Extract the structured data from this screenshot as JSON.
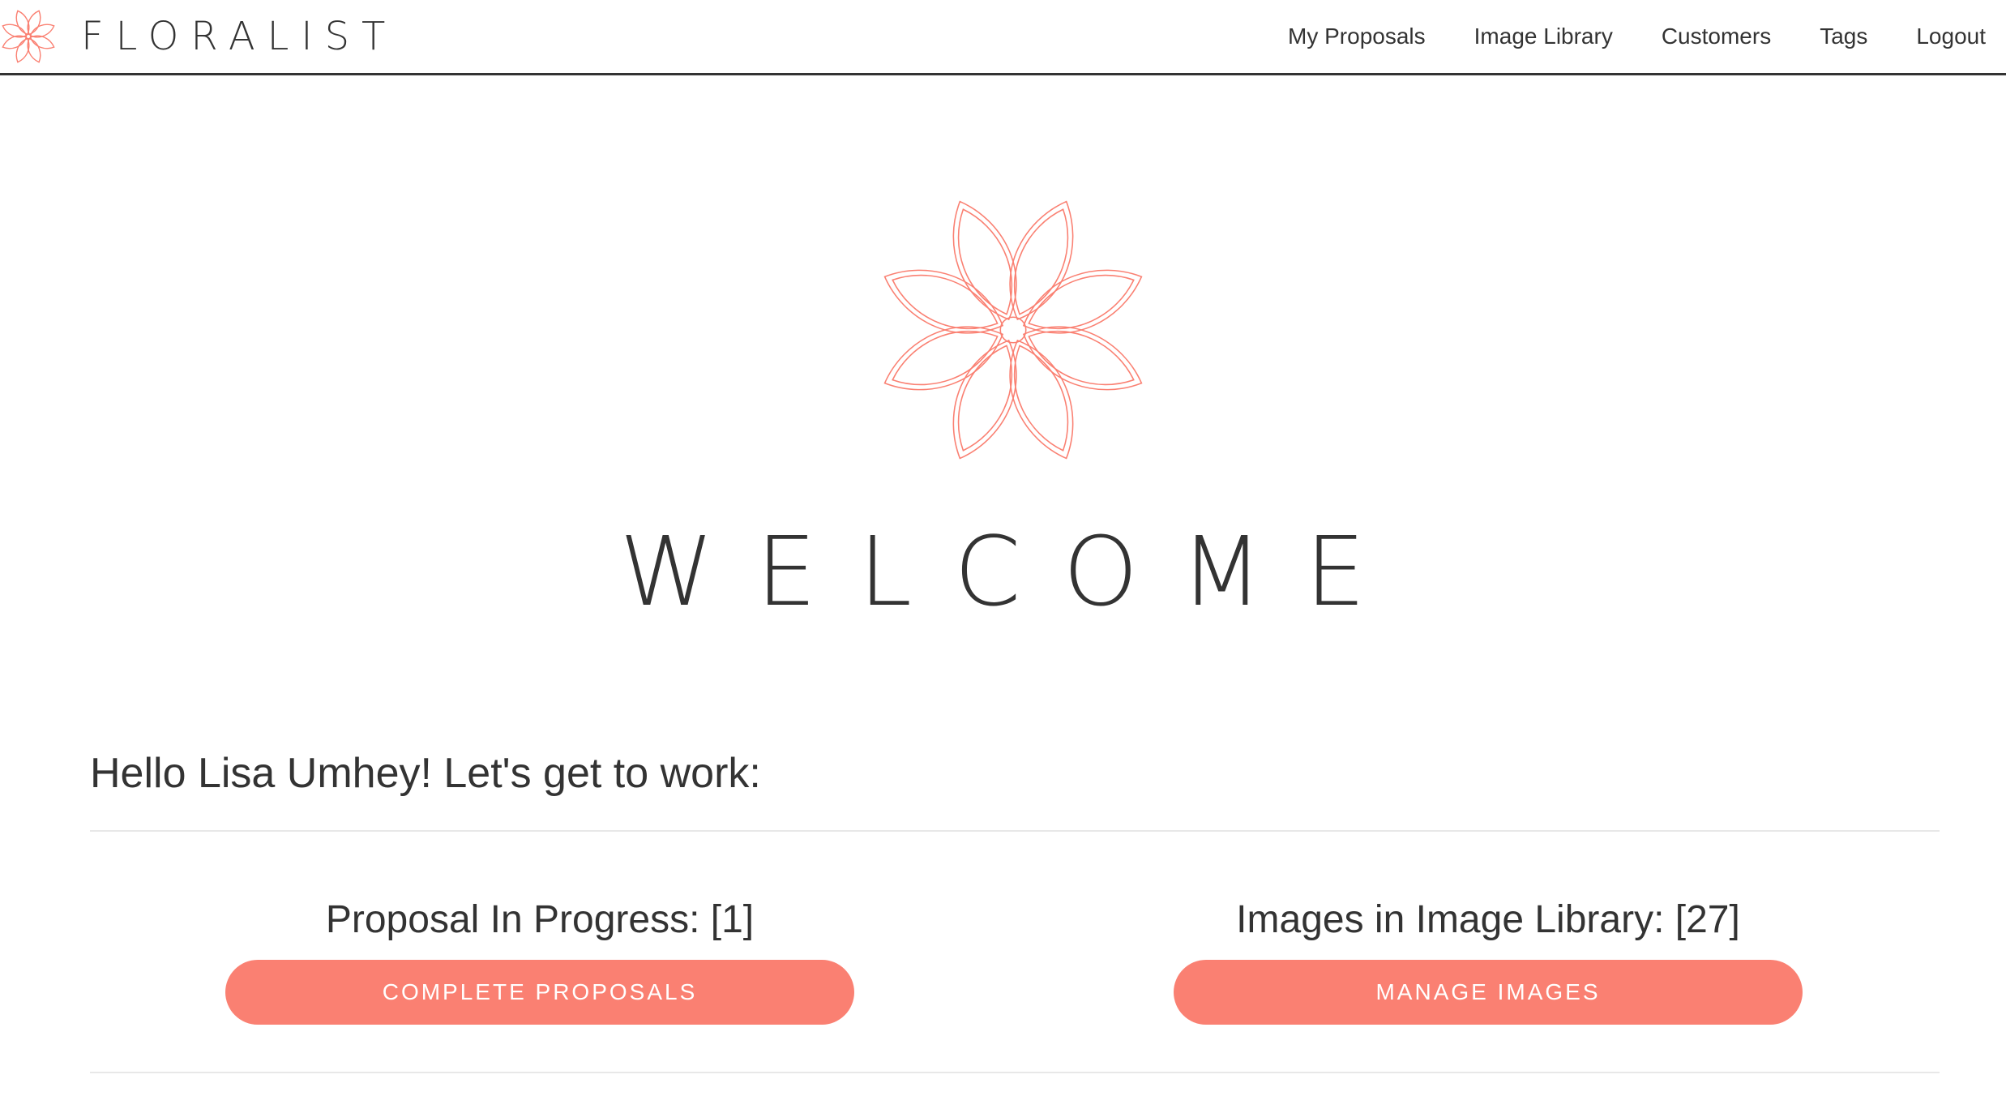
{
  "brand": {
    "name": "FLORALIST",
    "icon": "flower-icon"
  },
  "nav": {
    "items": [
      {
        "label": "My Proposals"
      },
      {
        "label": "Image Library"
      },
      {
        "label": "Customers"
      },
      {
        "label": "Tags"
      },
      {
        "label": "Logout"
      }
    ]
  },
  "hero": {
    "icon": "flower-icon",
    "title": "WELCOME"
  },
  "greeting": "Hello Lisa Umhey! Let's get to work:",
  "panels": {
    "proposals": {
      "stat": "Proposal In Progress: [1]",
      "button_label": "COMPLETE PROPOSALS"
    },
    "images": {
      "stat": "Images in Image Library: [27]",
      "button_label": "MANAGE IMAGES"
    }
  },
  "colors": {
    "accent": "#fa8072",
    "text": "#333333",
    "divider": "#e8e8e8",
    "background": "#ffffff"
  }
}
